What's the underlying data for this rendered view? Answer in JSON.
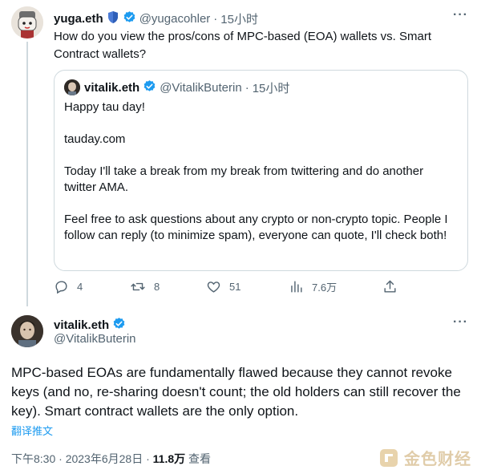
{
  "reply_tweet": {
    "display_name": "yuga.eth",
    "handle": "@yugacohler",
    "separator": "·",
    "time": "15小时",
    "text": "How do you view the pros/cons of MPC-based (EOA) wallets vs. Smart Contract wallets?",
    "more_label": "···"
  },
  "quoted_tweet": {
    "display_name": "vitalik.eth",
    "handle": "@VitalikButerin",
    "separator": "·",
    "time": "15小时",
    "paragraphs": [
      "Happy tau day!",
      "tauday.com",
      "Today I'll take a break from my break from twittering and do another twitter AMA.",
      "Feel free to ask questions about any crypto or non-crypto topic. People I follow can reply (to minimize spam), everyone can quote, I'll check both!"
    ]
  },
  "actions": {
    "replies": "4",
    "retweets": "8",
    "likes": "51",
    "views": "7.6万"
  },
  "main_tweet": {
    "display_name": "vitalik.eth",
    "handle": "@VitalikButerin",
    "more_label": "···",
    "text": "MPC-based EOAs are fundamentally flawed because they cannot revoke keys (and no, re-sharing doesn't count; the old holders can still recover the key). Smart contract wallets are the only option.",
    "translate_label": "翻译推文",
    "timestamp": "下午8:30 · 2023年6月28日 · ",
    "views_count": "11.8万",
    "views_label": " 查看"
  },
  "watermark": {
    "text": "金色财经"
  },
  "colors": {
    "verified_blue": "#1d9bf0",
    "secondary_text": "#536471",
    "border": "#cfd9de"
  }
}
